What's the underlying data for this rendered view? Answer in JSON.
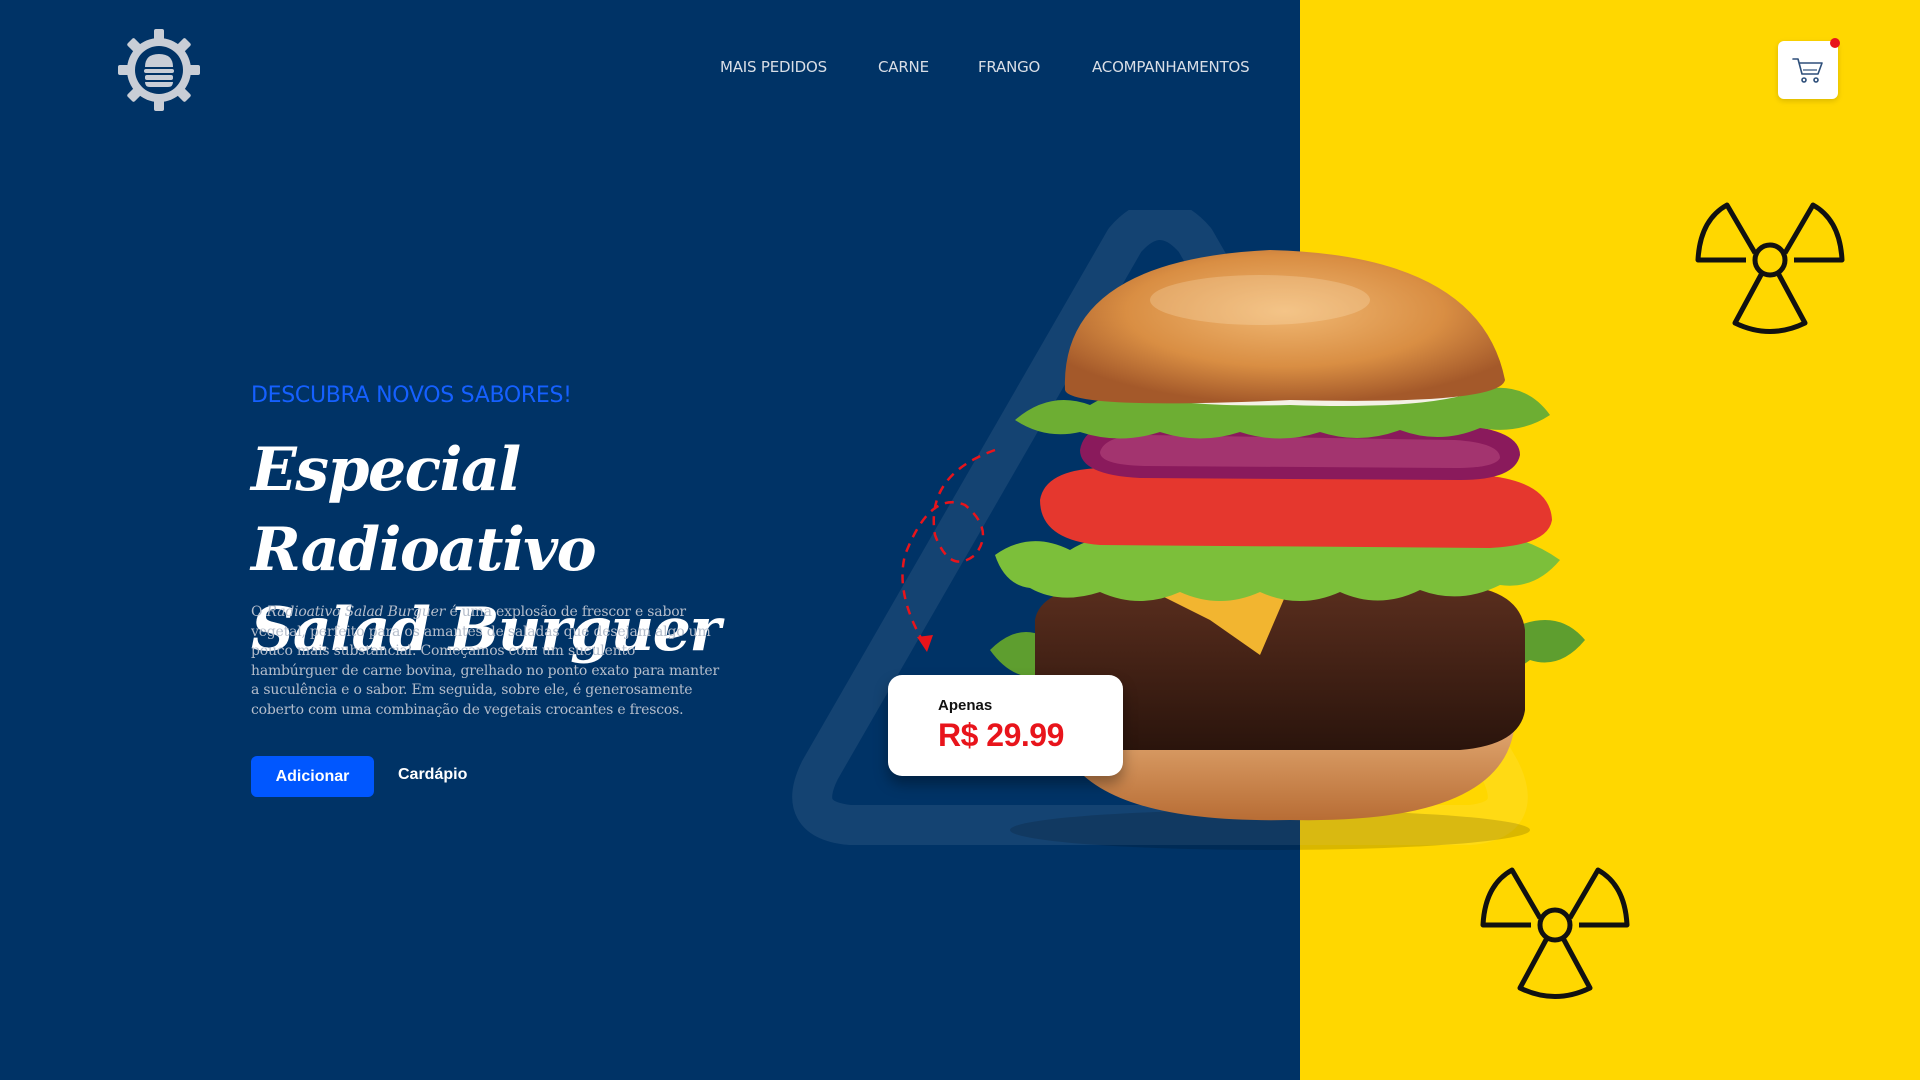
{
  "brand": {
    "logo_icon": "burger-gear-logo-icon"
  },
  "nav": {
    "items": [
      {
        "label": "MAIS PEDIDOS"
      },
      {
        "label": "CARNE"
      },
      {
        "label": "FRANGO"
      },
      {
        "label": "ACOMPANHAMENTOS"
      }
    ]
  },
  "cart": {
    "icon": "shopping-cart-icon",
    "has_notification": true
  },
  "hero": {
    "eyebrow": "DESCUBRA NOVOS SABORES!",
    "title_line1": "Especial Radioativo",
    "title_line2": "Salad Burguer",
    "desc_prefix": "O ",
    "desc_italic": "Radioativo Salad Burguer",
    "desc_rest": " é uma explosão de frescor e sabor vegetal, perfeito para os amantes de saladas que desejam algo um pouco mais substancial. Começamos com um suculento hambúrguer de carne bovina, grelhado no ponto exato para manter a suculência e o sabor. Em seguida, sobre ele, é generosamente coberto com uma combinação de vegetais crocantes e frescos.",
    "add_button": "Adicionar",
    "menu_button": "Cardápio"
  },
  "price": {
    "label": "Apenas",
    "value": "R$ 29.99"
  },
  "colors": {
    "navy": "#003366",
    "yellow": "#FFD700",
    "accent_blue": "#0057FF",
    "price_red": "#E8141B"
  }
}
